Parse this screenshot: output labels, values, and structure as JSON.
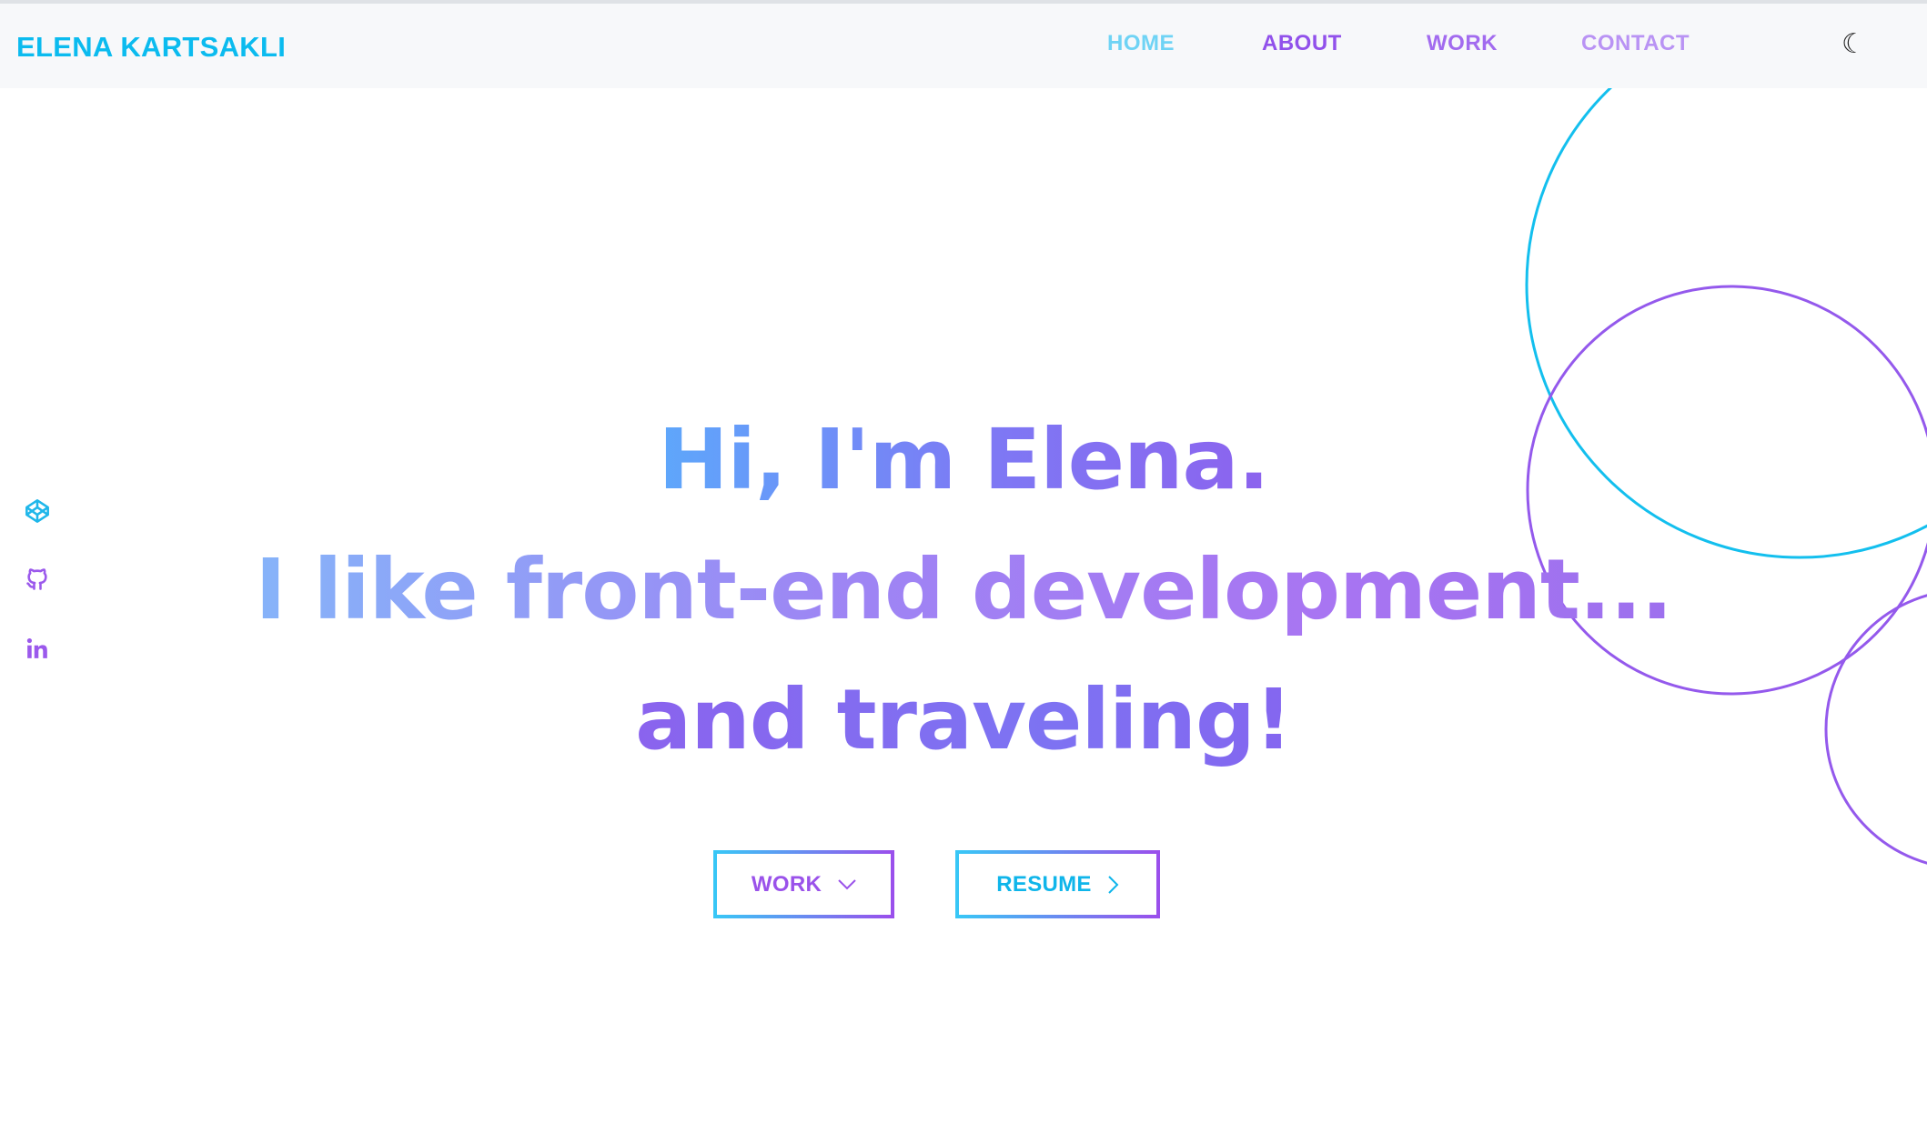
{
  "brand": {
    "name": "ELENA KARTSAKLI"
  },
  "nav": {
    "home": "HOME",
    "about": "ABOUT",
    "work": "WORK",
    "contact": "CONTACT",
    "theme_toggle": "☾"
  },
  "social": {
    "items": [
      {
        "name": "codepen",
        "icon": "codepen-icon",
        "color": "#1fb7ea"
      },
      {
        "name": "github",
        "icon": "github-icon",
        "color": "#9b59ec"
      },
      {
        "name": "linkedin",
        "icon": "linkedin-icon",
        "color": "#9b59ec"
      }
    ]
  },
  "hero": {
    "line1": "Hi, I'm Elena.",
    "line2": "I like front-end development...",
    "line3": "and traveling!"
  },
  "buttons": {
    "work": {
      "label": "WORK",
      "icon": "chevron-down-icon"
    },
    "resume": {
      "label": "RESUME",
      "icon": "chevron-right-icon"
    }
  },
  "colors": {
    "accent_cyan": "#0bbbef",
    "accent_purple": "#9151eb",
    "navbar_bg": "#f7f8fa"
  }
}
